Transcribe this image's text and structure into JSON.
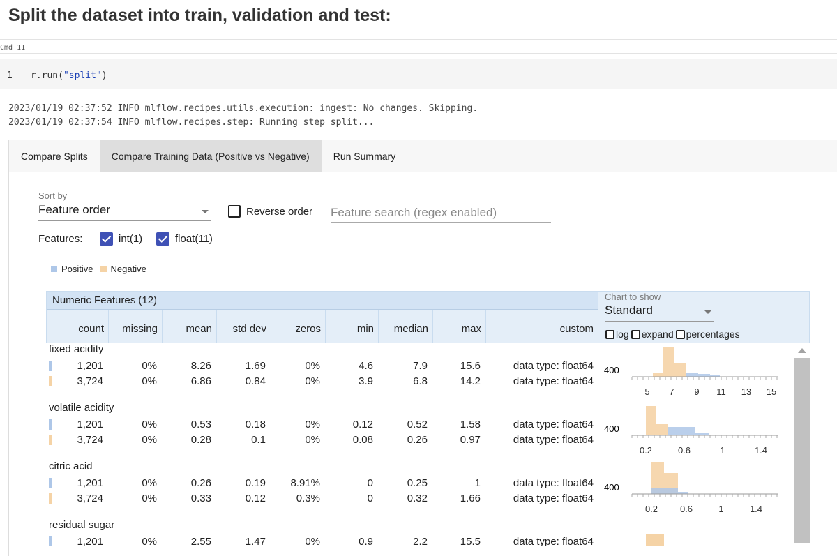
{
  "page": {
    "heading": "Split the dataset into train, validation and test:",
    "cmd_label": "Cmd 11"
  },
  "code_cell": {
    "line_number": "1",
    "code_prefix": "r.run(",
    "code_string": "\"split\"",
    "code_suffix": ")"
  },
  "log_lines": [
    "2023/01/19 02:37:52 INFO mlflow.recipes.utils.execution: ingest: No changes. Skipping.",
    "2023/01/19 02:37:54 INFO mlflow.recipes.step: Running step split..."
  ],
  "tabs": [
    {
      "label": "Compare Splits",
      "active": false
    },
    {
      "label": "Compare Training Data (Positive vs Negative)",
      "active": true
    },
    {
      "label": "Run Summary",
      "active": false
    }
  ],
  "toolbar": {
    "sort_by_label": "Sort by",
    "sort_by_value": "Feature order",
    "reverse_order_label": "Reverse order",
    "reverse_order_checked": false,
    "search_placeholder": "Feature search (regex enabled)",
    "search_value": ""
  },
  "features_filter": {
    "label": "Features:",
    "options": [
      {
        "label": "int(1)",
        "checked": true
      },
      {
        "label": "float(11)",
        "checked": true
      }
    ]
  },
  "legend": {
    "items": [
      {
        "label": "Positive",
        "color": "#aec7e8"
      },
      {
        "label": "Negative",
        "color": "#f5d3a6"
      }
    ]
  },
  "table": {
    "title": "Numeric Features (12)",
    "columns": [
      "count",
      "missing",
      "mean",
      "std dev",
      "zeros",
      "min",
      "median",
      "max",
      "custom"
    ],
    "chart_to_show_label": "Chart to show",
    "chart_to_show_value": "Standard",
    "chart_options": [
      "log",
      "expand",
      "percentages"
    ],
    "features": [
      {
        "name": "fixed acidity",
        "rows": [
          {
            "series": "Positive",
            "count": "1,201",
            "missing": "0%",
            "mean": "8.26",
            "std_dev": "1.69",
            "zeros": "0%",
            "min": "4.6",
            "median": "7.9",
            "max": "15.6",
            "custom": "data type: float64"
          },
          {
            "series": "Negative",
            "count": "3,724",
            "missing": "0%",
            "mean": "6.86",
            "std_dev": "0.84",
            "zeros": "0%",
            "min": "3.9",
            "median": "6.8",
            "max": "14.2",
            "custom": "data type: float64"
          }
        ],
        "chart_y_tick": "400",
        "chart_x_ticks": [
          "5",
          "7",
          "9",
          "11",
          "13",
          "15"
        ]
      },
      {
        "name": "volatile acidity",
        "rows": [
          {
            "series": "Positive",
            "count": "1,201",
            "missing": "0%",
            "mean": "0.53",
            "std_dev": "0.18",
            "zeros": "0%",
            "min": "0.12",
            "median": "0.52",
            "max": "1.58",
            "custom": "data type: float64"
          },
          {
            "series": "Negative",
            "count": "3,724",
            "missing": "0%",
            "mean": "0.28",
            "std_dev": "0.1",
            "zeros": "0%",
            "min": "0.08",
            "median": "0.26",
            "max": "0.97",
            "custom": "data type: float64"
          }
        ],
        "chart_y_tick": "400",
        "chart_x_ticks": [
          "0.2",
          "0.6",
          "1",
          "1.4"
        ]
      },
      {
        "name": "citric acid",
        "rows": [
          {
            "series": "Positive",
            "count": "1,201",
            "missing": "0%",
            "mean": "0.26",
            "std_dev": "0.19",
            "zeros": "8.91%",
            "min": "0",
            "median": "0.25",
            "max": "1",
            "custom": "data type: float64"
          },
          {
            "series": "Negative",
            "count": "3,724",
            "missing": "0%",
            "mean": "0.33",
            "std_dev": "0.12",
            "zeros": "0.3%",
            "min": "0",
            "median": "0.32",
            "max": "1.66",
            "custom": "data type: float64"
          }
        ],
        "chart_y_tick": "400",
        "chart_x_ticks": [
          "0.2",
          "0.6",
          "1",
          "1.4"
        ]
      },
      {
        "name": "residual sugar",
        "rows": [
          {
            "series": "Positive",
            "count": "1,201",
            "missing": "0%",
            "mean": "2.55",
            "std_dev": "1.47",
            "zeros": "0%",
            "min": "0.9",
            "median": "2.2",
            "max": "15.5",
            "custom": "data type: float64"
          }
        ]
      }
    ]
  },
  "colors": {
    "positive": "#aec7e8",
    "negative": "#f5d3a6",
    "checkbox_accent": "#3f51b5"
  }
}
